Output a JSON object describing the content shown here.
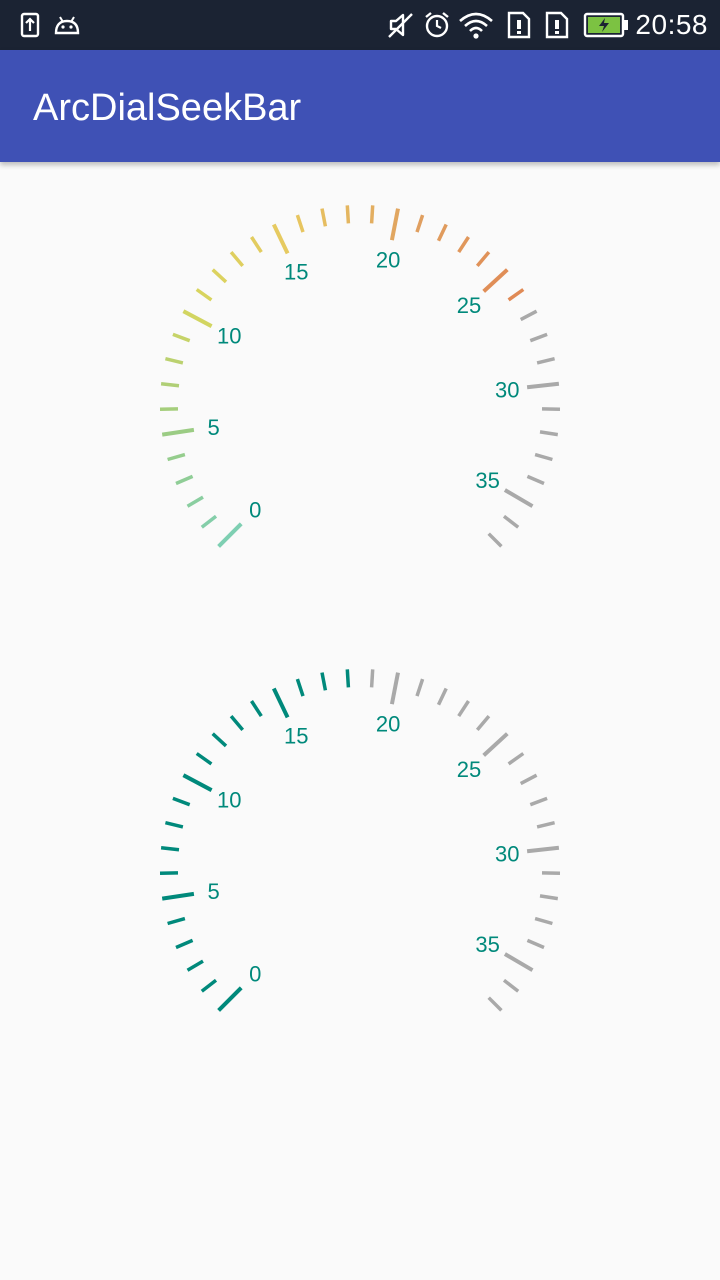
{
  "status_bar": {
    "time": "20:58",
    "icons": [
      "upload-notification-icon",
      "android-debug-icon",
      "mute-icon",
      "alarm-icon",
      "wifi-icon",
      "sim1-alert-icon",
      "sim2-alert-icon",
      "battery-charging-icon"
    ]
  },
  "app_bar": {
    "title": "ArcDialSeekBar"
  },
  "dials": [
    {
      "name": "gradient-dial",
      "min": 0,
      "max": 37,
      "value": 26,
      "labels": [
        "0",
        "5",
        "10",
        "15",
        "20",
        "25",
        "30",
        "35"
      ],
      "style": "gradient",
      "gradient_stops": [
        "#7ecfb2",
        "#9ccc82",
        "#d6d65e",
        "#e8c860",
        "#e0a060",
        "#e08a55"
      ],
      "inactive_color": "#a9a9a9",
      "label_color": "#00897b"
    },
    {
      "name": "solid-dial",
      "min": 0,
      "max": 37,
      "value": 18,
      "labels": [
        "0",
        "5",
        "10",
        "15",
        "20",
        "25",
        "30",
        "35"
      ],
      "style": "solid",
      "active_color": "#00897b",
      "inactive_color": "#a9a9a9",
      "label_color": "#00897b"
    }
  ]
}
